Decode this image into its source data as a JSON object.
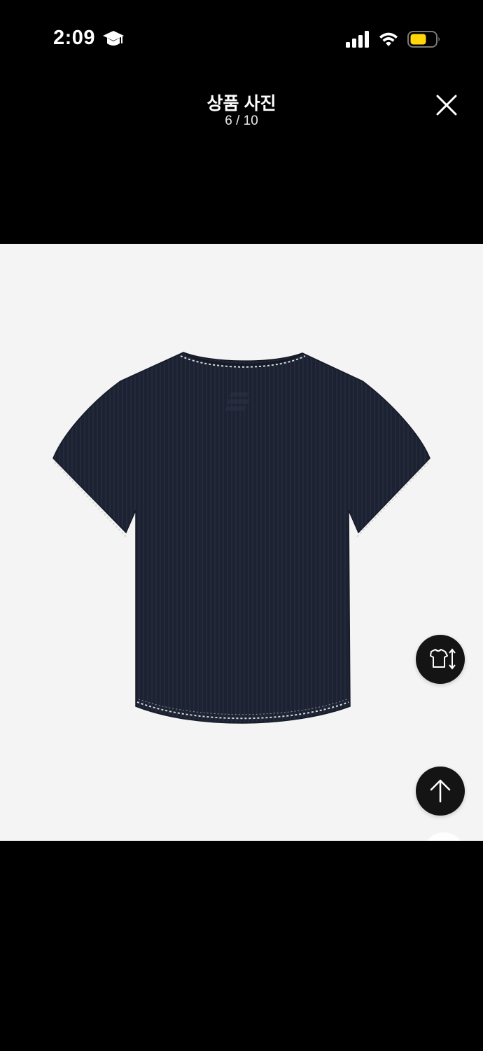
{
  "status_bar": {
    "time": "2:09",
    "icons": [
      "graduation-cap-icon",
      "signal-icon",
      "wifi-icon",
      "battery-icon"
    ],
    "battery_color": "#ffd60a"
  },
  "header": {
    "title": "상품 사진",
    "counter": "6 / 10",
    "close_icon": "close-icon"
  },
  "viewer": {
    "current_index": 6,
    "total": 10,
    "image_description_icon": "tshirt-back-image",
    "shirt_color": "#1c2231",
    "stitch_color": "#d8d8d8",
    "background_color": "#f4f4f4"
  },
  "floating_buttons": {
    "size_guide_icon": "shirt-size-icon",
    "scroll_top_icon": "arrow-up-icon",
    "button_color": "#141414"
  }
}
